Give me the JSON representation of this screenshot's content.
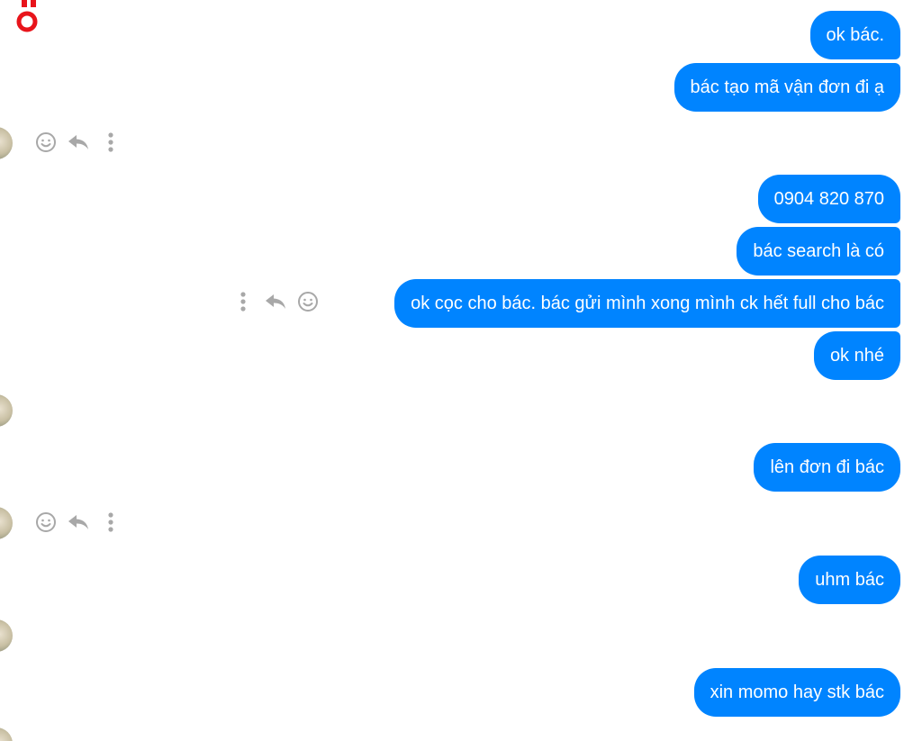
{
  "messages": [
    {
      "text": "ok bác."
    },
    {
      "text": "bác tạo mã vận đơn đi ạ"
    },
    {
      "text": "0904 820 870"
    },
    {
      "text": "bác search là có"
    },
    {
      "text": "ok cọc cho bác. bác gửi mình xong mình ck hết full cho bác"
    },
    {
      "text": "ok nhé"
    },
    {
      "text": "lên đơn đi bác"
    },
    {
      "text": "uhm bác"
    },
    {
      "text": "xin momo hay stk bác"
    }
  ],
  "colors": {
    "bubble": "#0084ff",
    "bubble_text": "#ffffff",
    "icon_gray": "#a8a8a8",
    "logo_red": "#e8141b"
  },
  "icons": {
    "emoji": "smiley-icon",
    "reply": "reply-icon",
    "more": "more-vertical-icon"
  }
}
